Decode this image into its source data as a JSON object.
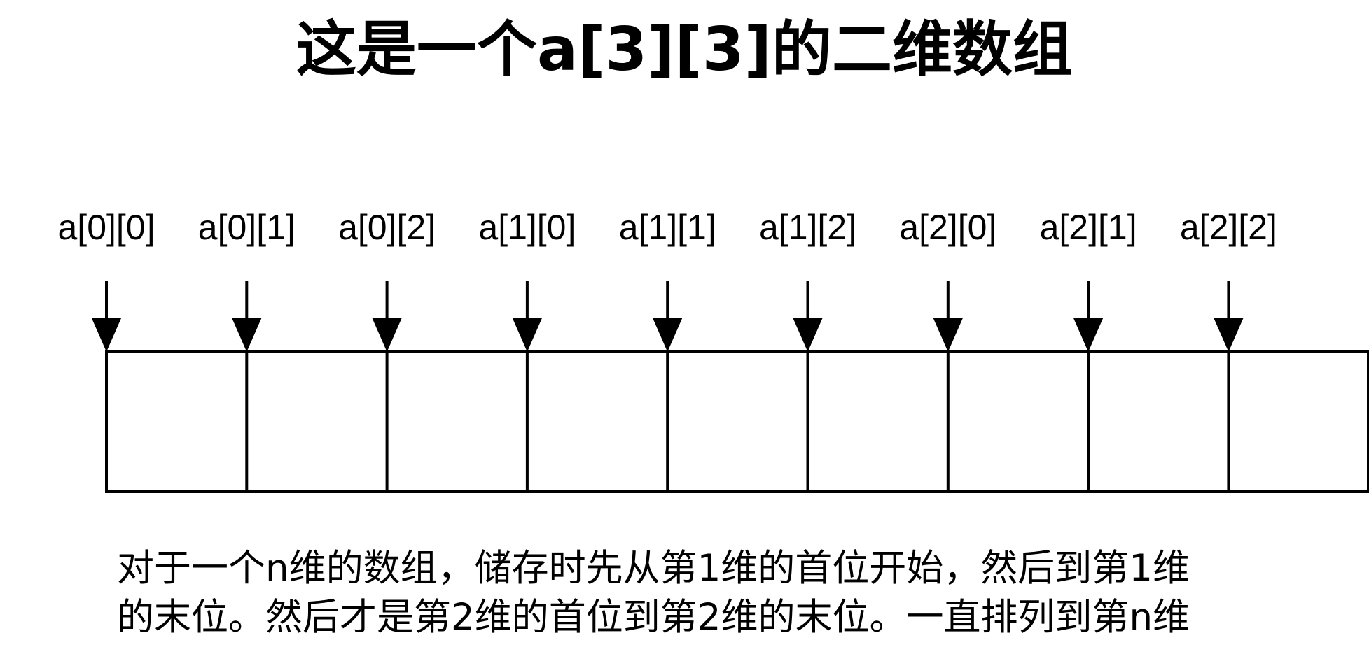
{
  "title": "这是一个a[3][3]的二维数组",
  "elements": [
    "a[0][0]",
    "a[0][1]",
    "a[0][2]",
    "a[1][0]",
    "a[1][1]",
    "a[1][2]",
    "a[2][0]",
    "a[2][1]",
    "a[2][2]"
  ],
  "caption": {
    "line1": "对于一个n维的数组，储存时先从第1维的首位开始，然后到第1维",
    "line2": "的末位。然后才是第2维的首位到第2维的末位。一直排列到第n维"
  },
  "colors": {
    "stroke": "#000000",
    "background": "#ffffff"
  }
}
